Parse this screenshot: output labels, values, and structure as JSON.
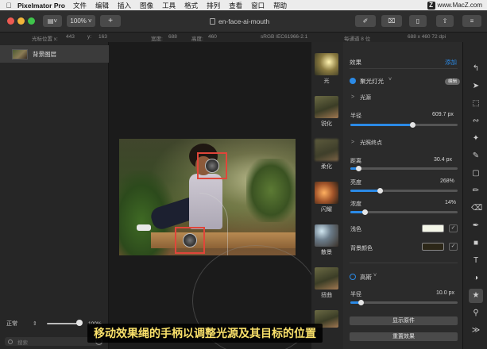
{
  "menubar": {
    "app": "Pixelmator Pro",
    "items": [
      "文件",
      "编辑",
      "插入",
      "图像",
      "工具",
      "格式",
      "排列",
      "查看",
      "窗口",
      "帮助"
    ],
    "watermark": "www.MacZ.com"
  },
  "toolbar": {
    "zoom": "100%",
    "add": "+",
    "document_title": "en-face-ai-mouth"
  },
  "infobar": {
    "cursor_x_label": "光标位置 x:",
    "cursor_x": "443",
    "cursor_y_label": "y:",
    "cursor_y": "163",
    "width_label": "宽度:",
    "width": "688",
    "height_label": "高度:",
    "height": "460",
    "color_profile": "sRGB IEC61966-2.1",
    "bit_depth": "每通道 8 位",
    "image_size": "688 x 460 72 dpi"
  },
  "layers": {
    "items": [
      {
        "name": "背景图层"
      }
    ],
    "blend_mode": "正常",
    "opacity": 1.0,
    "opacity_label": "100%",
    "search_placeholder": "搜索"
  },
  "effects_browser": [
    "光",
    "锐化",
    "柔化",
    "闪耀",
    "散景",
    "扭曲"
  ],
  "inspector": {
    "title": "效果",
    "add": "添加",
    "effect_name": "聚光灯光",
    "badge": "编辑",
    "light_section": "光源",
    "radius_label": "半径",
    "radius_value": "609.7 px",
    "radius_level": 0.58,
    "target_section": "光照终点",
    "distance_label": "距离",
    "distance_value": "30.4 px",
    "distance_level": 0.08,
    "brightness_label": "亮度",
    "brightness_value": "268%",
    "brightness_level": 0.28,
    "density_label": "浓度",
    "density_value": "14%",
    "density_level": 0.14,
    "tint_label": "浅色",
    "tint_color": "#f4f6e8",
    "bg_color_label": "背景颜色",
    "bg_color": "#2c2718",
    "gauss_label": "高斯",
    "gauss_radius_label": "半径",
    "gauss_radius_value": "10.0 px",
    "gauss_radius_level": 0.1,
    "show_original": "显示原件",
    "reset_effect": "重置效果"
  },
  "tools": [
    "arrange-icon",
    "select-icon",
    "marquee-icon",
    "lasso-icon",
    "magic-wand-icon",
    "brush-icon",
    "gradient-icon",
    "retouch-icon",
    "eraser-icon",
    "pen-icon",
    "shape-icon",
    "type-icon",
    "color-adjust-icon",
    "effects-icon",
    "zoom-icon",
    "more-icon"
  ],
  "caption": "移动效果绳的手柄以调整光源及其目标的位置",
  "colors": {
    "accent": "#2b8ae6",
    "handle": "#e0463a",
    "caption_text": "#f9e06a"
  }
}
